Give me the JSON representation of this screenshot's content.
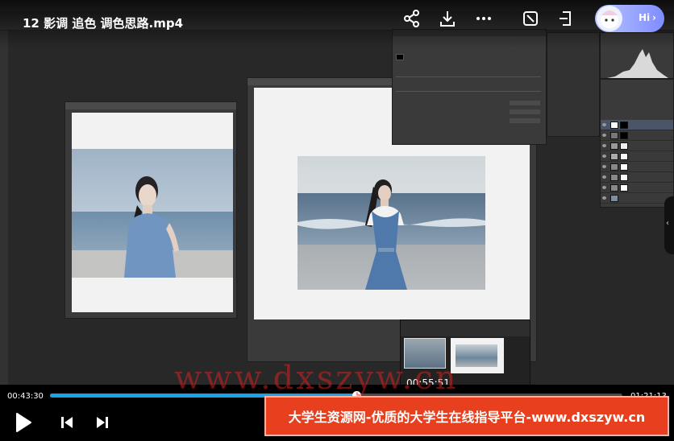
{
  "video": {
    "title": "12 影调 追色 调色思路.mp4",
    "current_time": "00:43:30",
    "total_time": "01:21:13",
    "hover_time": "00:55:51",
    "progress_fraction": 0.535,
    "hover_fraction": 0.5
  },
  "assistant": {
    "label": "Hi"
  },
  "watermark": {
    "text": "www.dxszyw.cn"
  },
  "banner": {
    "text": "大学生资源网-优质的大学生在线指导平台-www.dxszyw.cn"
  },
  "icons": {
    "share": "share-icon",
    "download": "download-icon",
    "more": "more-icon",
    "screenshot": "screenshot-icon",
    "exit": "exit-icon",
    "play": "play-icon",
    "previous": "skip-previous-icon",
    "next": "skip-next-icon"
  },
  "colors": {
    "progress": "#1aa3e8",
    "banner": "#e8401f",
    "watermark": "#e02020"
  }
}
